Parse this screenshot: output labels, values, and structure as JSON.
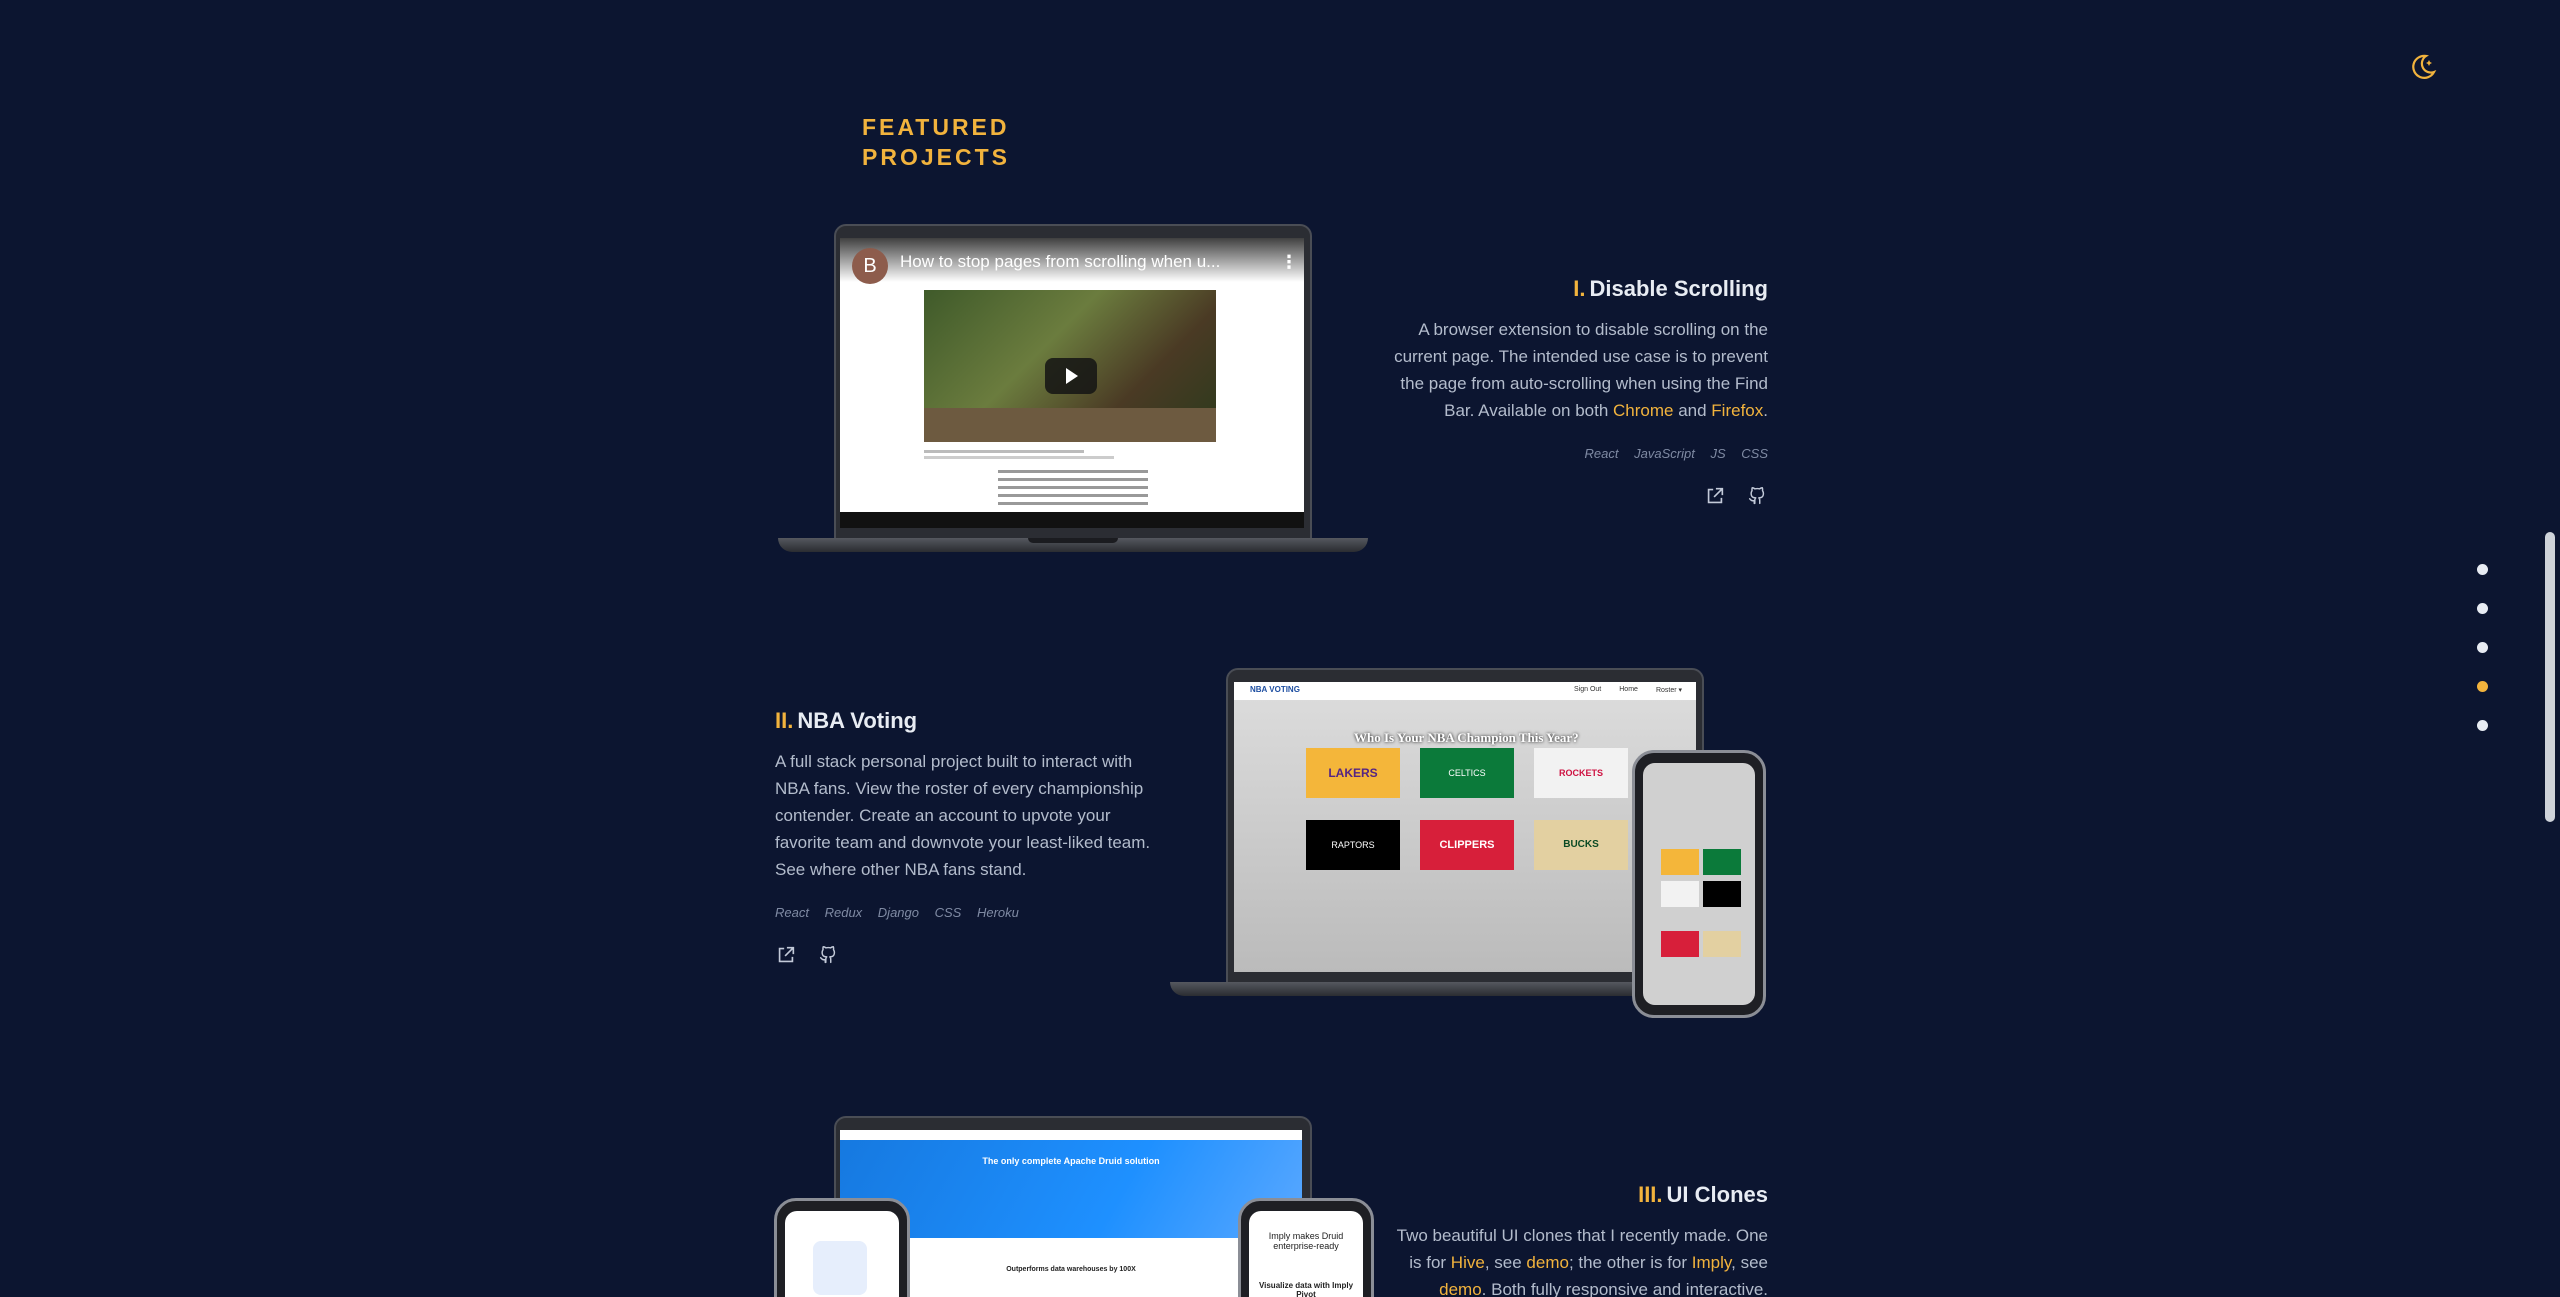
{
  "section_title": "FEATURED PROJECTS",
  "nav_dots": [
    "dot-1",
    "dot-2",
    "dot-3",
    "dot-4",
    "dot-5"
  ],
  "active_dot": 3,
  "projects": [
    {
      "num": "I.",
      "title": "Disable Scrolling",
      "desc_parts": [
        "A browser extension to disable scrolling on the current page. The intended use case is to prevent the page from auto-scrolling when using the Find Bar. Available on both ",
        "Chrome",
        " and ",
        "Firefox",
        "."
      ],
      "tags": [
        "React",
        "JavaScript",
        "JS",
        "CSS"
      ],
      "video": {
        "avatar_letter": "B",
        "title": "How to stop pages from scrolling when u..."
      }
    },
    {
      "num": "II.",
      "title": "NBA Voting",
      "desc": "A full stack personal project built to interact with NBA fans. View the roster of every championship contender. Create an account to upvote your favorite team and downvote your least-liked team. See where other NBA fans stand.",
      "tags": [
        "React",
        "Redux",
        "Django",
        "CSS",
        "Heroku"
      ],
      "mock": {
        "brand": "NBA VOTING",
        "nav": [
          "Sign Out",
          "Home",
          "Roster ▾"
        ],
        "headline": "Who Is Your NBA Champion This Year?",
        "teams": [
          "LAKERS",
          "CELTICS",
          "ROCKETS",
          "RAPTORS",
          "CLIPPERS",
          "BUCKS"
        ]
      }
    },
    {
      "num": "III.",
      "title": "UI Clones",
      "desc_parts": [
        "Two beautiful UI clones that I recently made. One is for ",
        "Hive",
        ", see ",
        "demo",
        "; the other is for ",
        "Imply",
        ", see ",
        "demo",
        ". Both fully responsive and interactive."
      ],
      "mock": {
        "hero": "The only complete Apache Druid solution",
        "sub": "Outperforms data warehouses by 100X",
        "phone_right": "Imply makes Druid enterprise-ready",
        "phone_right2": "Visualize data with Imply Pivot"
      }
    }
  ],
  "colors": {
    "background": "#0c1530",
    "accent": "#f2b33d",
    "text": "#b3bccc",
    "title": "#e8ecf3"
  }
}
